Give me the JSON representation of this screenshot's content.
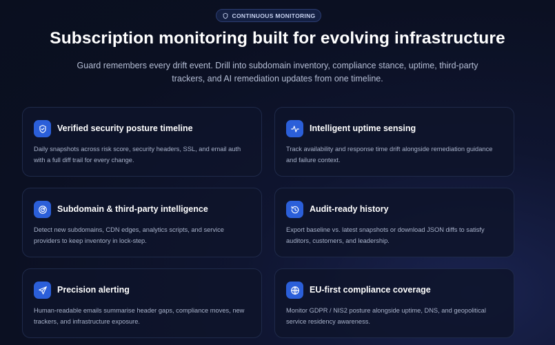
{
  "badge": {
    "label": "CONTINUOUS MONITORING",
    "icon": "shield-icon"
  },
  "header": {
    "title": "Subscription monitoring built for evolving infrastructure",
    "subtitle": "Guard remembers every drift event. Drill into subdomain inventory, compliance stance, uptime, third-party trackers, and AI remediation updates from one timeline."
  },
  "colors": {
    "accent": "#2b5fd9",
    "background": "#0b1022",
    "card_border": "#1f2a4a"
  },
  "features": [
    {
      "icon": "shield-check-icon",
      "title": "Verified security posture timeline",
      "description": "Daily snapshots across risk score, security headers, SSL, and email auth with a full diff trail for every change."
    },
    {
      "icon": "activity-icon",
      "title": "Intelligent uptime sensing",
      "description": "Track availability and response time drift alongside remediation guidance and failure context."
    },
    {
      "icon": "radar-icon",
      "title": "Subdomain & third-party intelligence",
      "description": "Detect new subdomains, CDN edges, analytics scripts, and service providers to keep inventory in lock-step."
    },
    {
      "icon": "history-icon",
      "title": "Audit-ready history",
      "description": "Export baseline vs. latest snapshots or download JSON diffs to satisfy auditors, customers, and leadership."
    },
    {
      "icon": "send-icon",
      "title": "Precision alerting",
      "description": "Human-readable emails summarise header gaps, compliance moves, new trackers, and infrastructure exposure."
    },
    {
      "icon": "globe-icon",
      "title": "EU-first compliance coverage",
      "description": "Monitor GDPR / NIS2 posture alongside uptime, DNS, and geopolitical service residency awareness."
    }
  ]
}
